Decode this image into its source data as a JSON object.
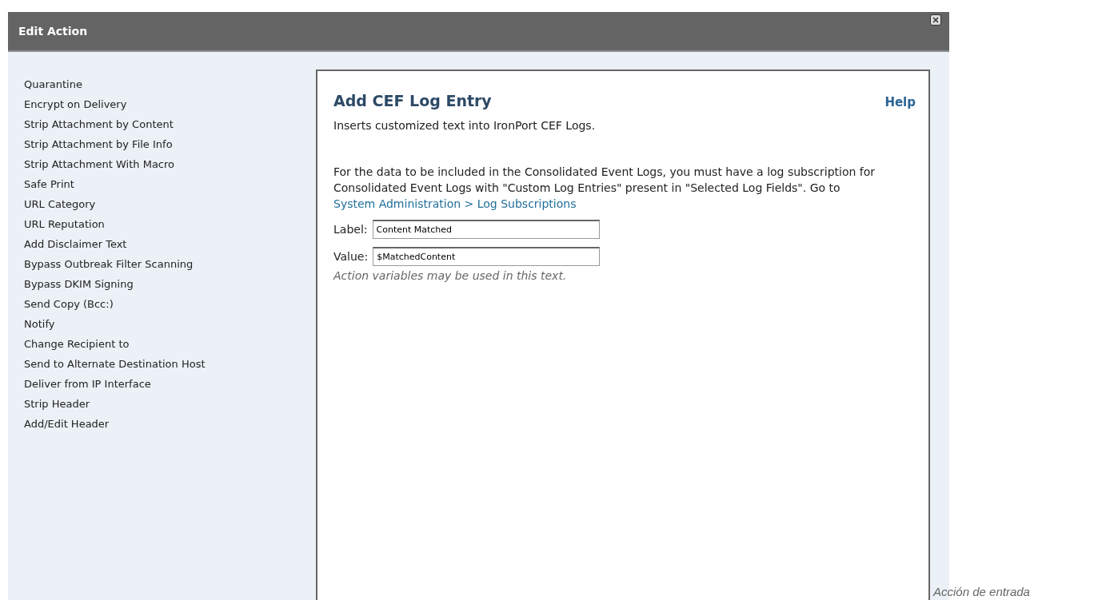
{
  "dialog": {
    "title": "Edit Action"
  },
  "actions": [
    {
      "label": "Quarantine"
    },
    {
      "label": "Encrypt on Delivery"
    },
    {
      "label": "Strip Attachment by Content"
    },
    {
      "label": "Strip Attachment by File Info"
    },
    {
      "label": "Strip Attachment With Macro"
    },
    {
      "label": "Safe Print"
    },
    {
      "label": "URL Category"
    },
    {
      "label": "URL Reputation"
    },
    {
      "label": "Add Disclaimer Text"
    },
    {
      "label": "Bypass Outbreak Filter Scanning"
    },
    {
      "label": "Bypass DKIM Signing"
    },
    {
      "label": "Send Copy (Bcc:)"
    },
    {
      "label": "Notify"
    },
    {
      "label": "Change Recipient to"
    },
    {
      "label": "Send to Alternate Destination Host"
    },
    {
      "label": "Deliver from IP Interface"
    },
    {
      "label": "Strip Header"
    },
    {
      "label": "Add/Edit Header"
    }
  ],
  "panel": {
    "title": "Add CEF Log Entry",
    "help": "Help",
    "description": "Inserts customized text into IronPort CEF Logs.",
    "note": "For the data to be included in the Consolidated Event Logs, you must have a log subscription for Consolidated Event Logs with \"Custom Log Entries\" present in \"Selected Log Fields\". Go to",
    "note_link": "System Administration > Log Subscriptions",
    "fields": [
      {
        "label": "Label:",
        "value": "Content Matched"
      },
      {
        "label": "Value:",
        "value": "$MatchedContent"
      }
    ],
    "hint": "Action variables may be used in this text."
  },
  "caption": "Acción de entrada"
}
